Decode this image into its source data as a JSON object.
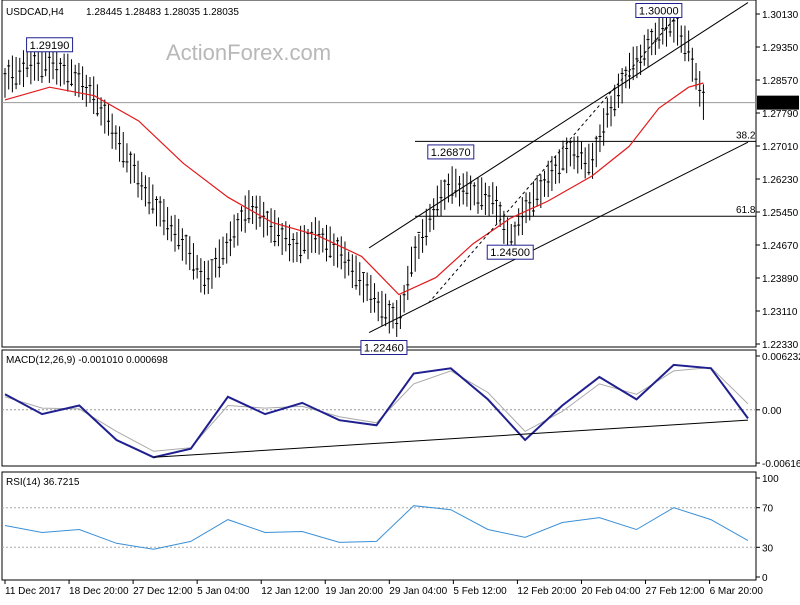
{
  "header": {
    "instrument": "USDCAD,H4",
    "ohlc": "1.28445 1.28483 1.28035 1.28035"
  },
  "watermark": "ActionForex.com",
  "colors": {
    "candles": "#000000",
    "ma": "#e31a1c",
    "channel": "#000000",
    "fib": "#000000",
    "macd_line": "#1f1f8f",
    "macd_signal": "#aaaaaa",
    "rsi": "#3a8fd6",
    "current_price_bg": "#000000",
    "current_price_text": "#ffffff"
  },
  "chart_data": [
    {
      "type": "line",
      "panel": "price",
      "title": "USDCAD,H4",
      "ylim": [
        1.2233,
        1.3013
      ],
      "y_ticks": [
        "1.30130",
        "1.29350",
        "1.28570",
        "1.27790",
        "1.27010",
        "1.26230",
        "1.25450",
        "1.24670",
        "1.23890",
        "1.23110",
        "1.22330"
      ],
      "current_price": "1.28035",
      "annotations": [
        {
          "label": "1.29190",
          "x": 0.06,
          "y": 1.2919
        },
        {
          "label": "1.30000",
          "x": 0.88,
          "y": 1.3
        },
        {
          "label": "1.26870",
          "x": 0.6,
          "y": 1.2687
        },
        {
          "label": "1.24500",
          "x": 0.68,
          "y": 1.245
        },
        {
          "label": "1.22460",
          "x": 0.51,
          "y": 1.2246
        }
      ],
      "fib_levels": [
        {
          "label": "38.2",
          "y": 1.2712
        },
        {
          "label": "61.8",
          "y": 1.2535
        }
      ],
      "series": [
        {
          "name": "price",
          "x": [
            0,
            0.03,
            0.06,
            0.09,
            0.12,
            0.15,
            0.18,
            0.21,
            0.24,
            0.27,
            0.3,
            0.33,
            0.36,
            0.39,
            0.42,
            0.45,
            0.48,
            0.51,
            0.53,
            0.55,
            0.58,
            0.6,
            0.63,
            0.66,
            0.68,
            0.7,
            0.73,
            0.76,
            0.79,
            0.81,
            0.84,
            0.86,
            0.88,
            0.9,
            0.92,
            0.94
          ],
          "values": [
            1.286,
            1.289,
            1.2895,
            1.287,
            1.282,
            1.272,
            1.262,
            1.254,
            1.247,
            1.238,
            1.247,
            1.256,
            1.251,
            1.246,
            1.249,
            1.245,
            1.238,
            1.231,
            1.229,
            1.244,
            1.256,
            1.261,
            1.259,
            1.257,
            1.247,
            1.255,
            1.262,
            1.269,
            1.266,
            1.277,
            1.288,
            1.292,
            1.297,
            1.299,
            1.293,
            1.28035
          ]
        },
        {
          "name": "ma",
          "x": [
            0,
            0.06,
            0.12,
            0.18,
            0.24,
            0.3,
            0.36,
            0.42,
            0.48,
            0.53,
            0.58,
            0.63,
            0.68,
            0.73,
            0.79,
            0.84,
            0.88,
            0.92,
            0.94
          ],
          "values": [
            1.281,
            1.284,
            1.282,
            1.276,
            1.266,
            1.258,
            1.252,
            1.249,
            1.244,
            1.235,
            1.239,
            1.247,
            1.253,
            1.257,
            1.263,
            1.27,
            1.279,
            1.284,
            1.285
          ]
        }
      ],
      "x_labels": [
        "11 Dec 2017",
        "18 Dec 20:00",
        "27 Dec 12:00",
        "5 Jan 04:00",
        "12 Jan 12:00",
        "19 Jan 20:00",
        "29 Jan 04:00",
        "5 Feb 12:00",
        "12 Feb 20:00",
        "20 Feb 04:00",
        "27 Feb 12:00",
        "6 Mar 20:00"
      ]
    },
    {
      "type": "line",
      "panel": "macd",
      "title": "MACD(12,26,9) -0.001010 0.000698",
      "ylim": [
        -0.00616,
        0.00623
      ],
      "y_ticks": [
        "0.006232",
        "0.00",
        "-0.006163"
      ],
      "series": [
        {
          "name": "macd",
          "x": [
            0,
            0.05,
            0.1,
            0.15,
            0.2,
            0.25,
            0.3,
            0.35,
            0.4,
            0.45,
            0.5,
            0.55,
            0.6,
            0.65,
            0.7,
            0.75,
            0.8,
            0.85,
            0.9,
            0.95,
            1.0
          ],
          "values": [
            0.0018,
            -0.0005,
            0.0005,
            -0.0035,
            -0.0055,
            -0.0045,
            0.0015,
            -0.0005,
            0.0008,
            -0.0012,
            -0.0018,
            0.0042,
            0.0048,
            0.0012,
            -0.0035,
            0.0005,
            0.0038,
            0.0012,
            0.0052,
            0.0048,
            -0.001
          ]
        },
        {
          "name": "signal",
          "x": [
            0,
            0.05,
            0.1,
            0.15,
            0.2,
            0.25,
            0.3,
            0.35,
            0.4,
            0.45,
            0.5,
            0.55,
            0.6,
            0.65,
            0.7,
            0.75,
            0.8,
            0.85,
            0.9,
            0.95,
            1.0
          ],
          "values": [
            0.0015,
            0.0002,
            0.0001,
            -0.0025,
            -0.0048,
            -0.0044,
            0.0005,
            0.0002,
            0.0004,
            -0.0008,
            -0.0015,
            0.003,
            0.0045,
            0.002,
            -0.0025,
            -0.0002,
            0.003,
            0.0018,
            0.0045,
            0.0049,
            0.0007
          ]
        }
      ]
    },
    {
      "type": "line",
      "panel": "rsi",
      "title": "RSI(14) 36.7215",
      "ylim": [
        0,
        100
      ],
      "y_ticks": [
        "100",
        "70",
        "30",
        "0"
      ],
      "series": [
        {
          "name": "rsi",
          "x": [
            0,
            0.05,
            0.1,
            0.15,
            0.2,
            0.25,
            0.3,
            0.35,
            0.4,
            0.45,
            0.5,
            0.55,
            0.6,
            0.65,
            0.7,
            0.75,
            0.8,
            0.85,
            0.9,
            0.95,
            1.0
          ],
          "values": [
            52,
            45,
            48,
            34,
            28,
            36,
            58,
            45,
            46,
            35,
            36,
            72,
            68,
            48,
            40,
            55,
            60,
            48,
            70,
            58,
            36.7215
          ]
        }
      ]
    }
  ]
}
